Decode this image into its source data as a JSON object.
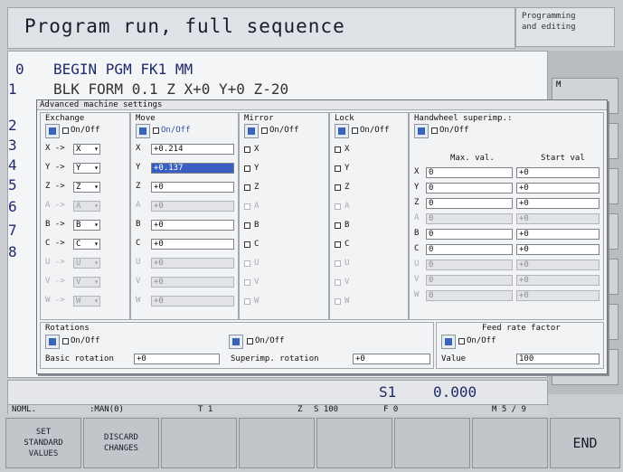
{
  "header": {
    "title": "Program run, full sequence",
    "mode_line1": "Programming",
    "mode_line2": "and editing"
  },
  "program": {
    "line0_num": "0",
    "line0_text": "BEGIN PGM FK1 MM",
    "line1_num": "1",
    "line1_text": "BLK FORM 0.1 Z  X+0  Y+0  Z-20",
    "line_nums": [
      "2",
      "3",
      "4",
      "5",
      "6",
      "7",
      "8"
    ]
  },
  "right_softkey": {
    "m_label": "M"
  },
  "dialog": {
    "title": "Advanced machine settings",
    "exchange": {
      "title": "Exchange",
      "onoff": "On/Off",
      "rows": [
        {
          "label": "X ->",
          "value": "X"
        },
        {
          "label": "Y ->",
          "value": "Y"
        },
        {
          "label": "Z ->",
          "value": "Z"
        },
        {
          "label": "A ->",
          "value": "A"
        },
        {
          "label": "B ->",
          "value": "B"
        },
        {
          "label": "C ->",
          "value": "C"
        },
        {
          "label": "U ->",
          "value": "U"
        },
        {
          "label": "V ->",
          "value": "V"
        },
        {
          "label": "W ->",
          "value": "W"
        }
      ]
    },
    "move": {
      "title": "Move",
      "onoff": "On/Off",
      "rows": [
        {
          "axis": "X",
          "value": "+0.214"
        },
        {
          "axis": "Y",
          "value": "+0.137"
        },
        {
          "axis": "Z",
          "value": "+0"
        },
        {
          "axis": "A",
          "value": "+0"
        },
        {
          "axis": "B",
          "value": "+0"
        },
        {
          "axis": "C",
          "value": "+0"
        },
        {
          "axis": "U",
          "value": "+0"
        },
        {
          "axis": "V",
          "value": "+0"
        },
        {
          "axis": "W",
          "value": "+0"
        }
      ]
    },
    "mirror": {
      "title": "Mirror",
      "onoff": "On/Off",
      "axes": [
        "X",
        "Y",
        "Z",
        "A",
        "B",
        "C",
        "U",
        "V",
        "W"
      ]
    },
    "lock": {
      "title": "Lock",
      "onoff": "On/Off",
      "axes": [
        "X",
        "Y",
        "Z",
        "A",
        "B",
        "C",
        "U",
        "V",
        "W"
      ]
    },
    "handwheel": {
      "title": "Handwheel superimp.:",
      "onoff": "On/Off",
      "col_max": "Max. val.",
      "col_start": "Start val",
      "rows": [
        {
          "axis": "X",
          "max": "0",
          "start": "+0"
        },
        {
          "axis": "Y",
          "max": "0",
          "start": "+0"
        },
        {
          "axis": "Z",
          "max": "0",
          "start": "+0"
        },
        {
          "axis": "A",
          "max": "0",
          "start": "+0"
        },
        {
          "axis": "B",
          "max": "0",
          "start": "+0"
        },
        {
          "axis": "C",
          "max": "0",
          "start": "+0"
        },
        {
          "axis": "U",
          "max": "0",
          "start": "+0"
        },
        {
          "axis": "V",
          "max": "0",
          "start": "+0"
        },
        {
          "axis": "W",
          "max": "0",
          "start": "+0"
        }
      ]
    },
    "rotations": {
      "title": "Rotations",
      "onoff": "On/Off",
      "basic_label": "Basic rotation",
      "basic_value": "+0",
      "superimp_onoff": "On/Off",
      "superimp_label": "Superimp. rotation",
      "superimp_value": "+0"
    },
    "feed": {
      "title": "Feed rate factor",
      "onoff": "On/Off",
      "value_label": "Value",
      "value": "100"
    }
  },
  "status": {
    "s1_label": "S1",
    "s1_value": "0.000",
    "noml": "NOML.",
    "man": ":MAN(0)",
    "t": "T 1",
    "z": "Z",
    "s": "S 100",
    "f": "F 0",
    "m": "M 5 / 9"
  },
  "softkeys": {
    "set_l1": "SET",
    "set_l2": "STANDARD",
    "set_l3": "VALUES",
    "discard_l1": "DISCARD",
    "discard_l2": "CHANGES",
    "end": "END"
  }
}
